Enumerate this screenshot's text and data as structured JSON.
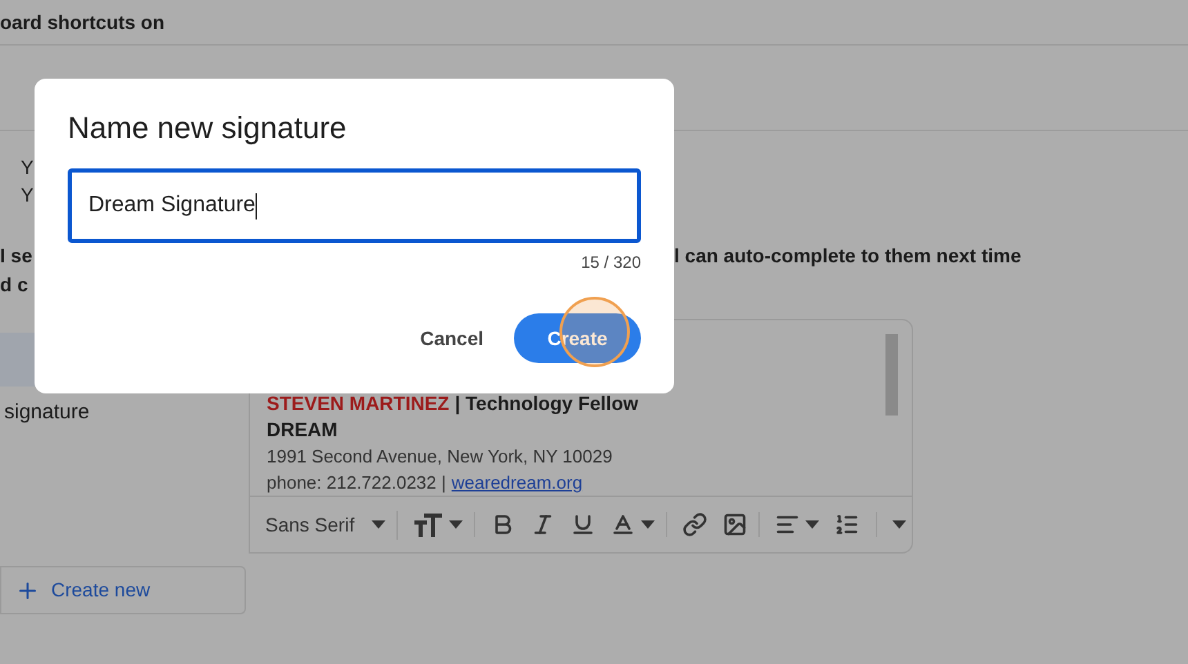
{
  "background": {
    "shortcuts_text": "oard shortcuts on",
    "lines": [
      "Y",
      "Y"
    ],
    "autocomplete_left": [
      "I se",
      "d c"
    ],
    "autocomplete_right": "l can auto-complete to them next time"
  },
  "signatures": {
    "items": [
      {
        "selected": true
      },
      {
        "label": "signature",
        "selected": false
      }
    ]
  },
  "editor": {
    "name": "STEVEN MARTINEZ",
    "title": "| Technology Fellow",
    "org": "DREAM",
    "address": "1991 Second Avenue, New York, NY 10029",
    "phone": "phone: 212.722.0232 |",
    "link": "wearedream.org",
    "toolbar": [
      {
        "kind": "font",
        "label": "Sans Serif"
      },
      {
        "kind": "size"
      },
      {
        "kind": "bold"
      },
      {
        "kind": "italic"
      },
      {
        "kind": "underline"
      },
      {
        "kind": "color"
      },
      {
        "kind": "link"
      },
      {
        "kind": "image"
      },
      {
        "kind": "align"
      },
      {
        "kind": "numbered"
      },
      {
        "kind": "more"
      }
    ]
  },
  "create_new": "Create new",
  "dialog": {
    "title": "Name new signature",
    "value": "Dream Signature",
    "counter": "15 / 320",
    "buttons": [
      {
        "kind": "text",
        "label": "Cancel"
      },
      {
        "kind": "primary",
        "label": "Create"
      }
    ]
  }
}
